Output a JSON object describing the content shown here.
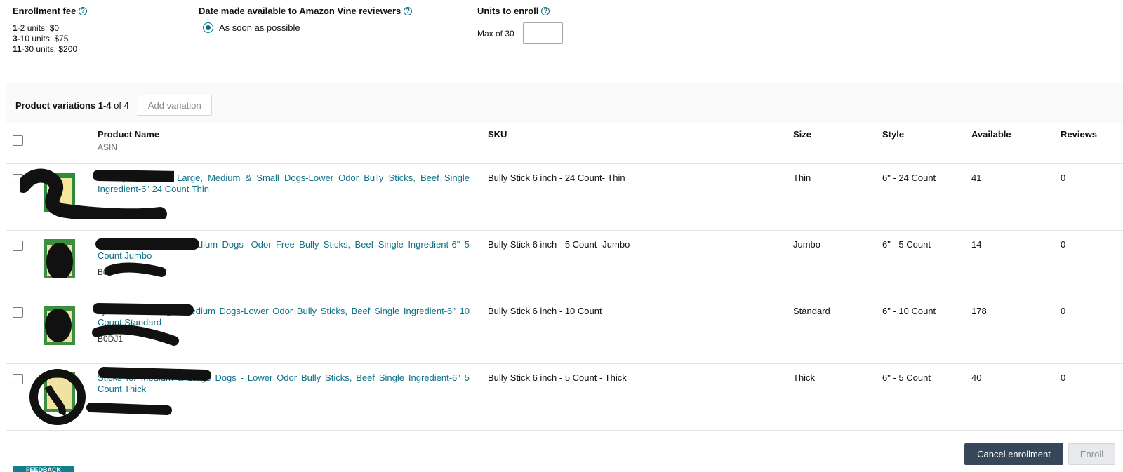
{
  "enrollment": {
    "fee_title": "Enrollment fee",
    "fee_lines": [
      {
        "range": "1",
        "rest": "-2 units: $0"
      },
      {
        "range": "3",
        "rest": "-10 units: $75"
      },
      {
        "range": "11",
        "rest": "-30 units: $200"
      }
    ],
    "date_title": "Date made available to Amazon Vine reviewers",
    "date_option": "As soon as possible",
    "units_title": "Units to enroll",
    "units_max_label": "Max of 30",
    "units_value": ""
  },
  "variations": {
    "label_bold": "Product variations 1-4",
    "label_rest": " of 4",
    "add_button": "Add variation"
  },
  "table": {
    "headers": {
      "product_name": "Product Name",
      "asin": "ASIN",
      "sku": "SKU",
      "size": "Size",
      "style": "Style",
      "available": "Available",
      "reviews": "Reviews"
    },
    "rows": [
      {
        "name": "s Bully Sticks for Large, Medium & Small Dogs-Lower Odor Bully Sticks, Beef Single Ingredient-6\" 24 Count Thin",
        "asin": "",
        "sku": "Bully Stick 6 inch - 24 Count- Thin",
        "size": "Thin",
        "style": "6\" - 24 Count",
        "available": "41",
        "reviews": "0"
      },
      {
        "name": "lly Sticks for Large, Medium Dogs- Odor Free Bully Sticks, Beef Single Ingredient-6\" 5 Count Jumbo",
        "asin": "B0D",
        "sku": "Bully Stick 6 inch - 5 Count -Jumbo",
        "size": "Jumbo",
        "style": "6\" - 5 Count",
        "available": "14",
        "reviews": "0"
      },
      {
        "name": "lly Sticks for Large, Medium Dogs-Lower Odor Bully Sticks, Beef Single Ingredient-6\" 10 Count Standard",
        "asin": "B0DJ1",
        "sku": "Bully Stick 6 inch - 10 Count",
        "size": "Standard",
        "style": "6\" - 10 Count",
        "available": "178",
        "reviews": "0"
      },
      {
        "name": "Sticks for Medium & Large Dogs - Lower Odor Bully Sticks, Beef Single Ingredient-6\" 5 Count Thick",
        "asin": "",
        "sku": "Bully Stick 6 inch - 5 Count - Thick",
        "size": "Thick",
        "style": "6\" - 5 Count",
        "available": "40",
        "reviews": "0"
      }
    ]
  },
  "actions": {
    "cancel": "Cancel enrollment",
    "enroll": "Enroll",
    "feedback": "FEEDBACK"
  },
  "colors": {
    "link": "#0d7187",
    "accent": "#007185",
    "cancel_bg": "#37475a",
    "enroll_disabled_bg": "#e7e9ec"
  }
}
